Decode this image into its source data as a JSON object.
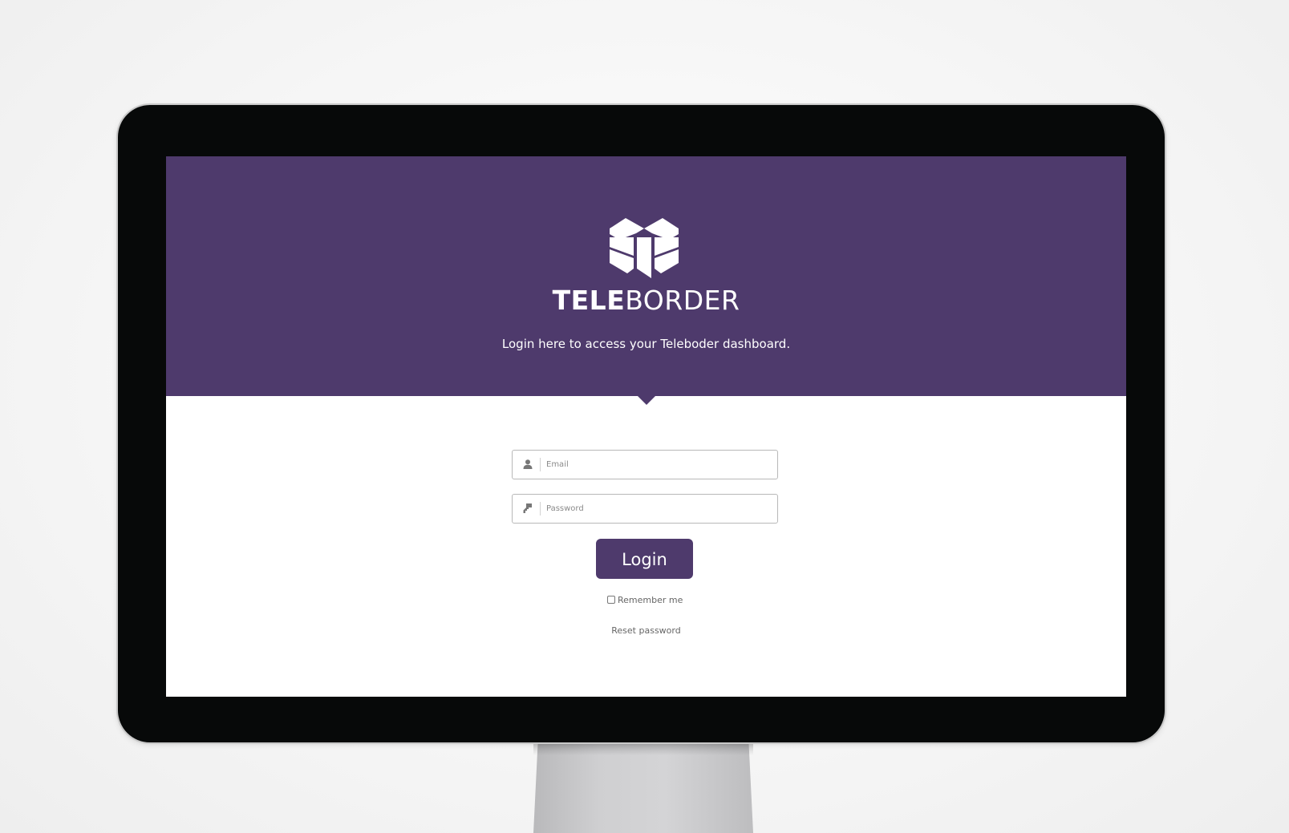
{
  "brand": {
    "name_bold": "TELE",
    "name_light": "BORDER",
    "tagline": "Login here to access your Teleboder dashboard."
  },
  "form": {
    "email": {
      "placeholder": "Email",
      "value": "",
      "icon": "user-icon"
    },
    "password": {
      "placeholder": "Password",
      "value": "",
      "icon": "key-icon"
    },
    "login_label": "Login",
    "remember_label": "Remember me",
    "remember_checked": false,
    "reset_label": "Reset password"
  },
  "colors": {
    "accent": "#4e3a6c",
    "screen_bg": "#ffffff",
    "bezel": "#070909"
  }
}
